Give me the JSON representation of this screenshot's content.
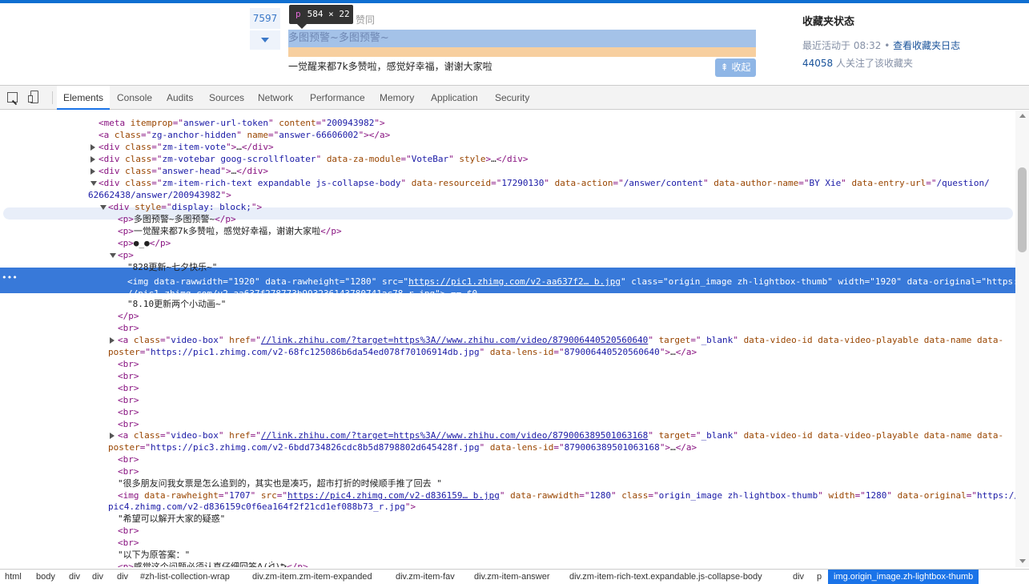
{
  "zhihu": {
    "vote_count": "7597",
    "tooltip_tag": "p",
    "tooltip_size": "584 × 22",
    "zan_label": "赞同",
    "highlighted_text": "多图预警~多图预警~",
    "line2": "一觉醒来都7k多赞啦，感觉好幸福，谢谢大家啦",
    "collapse_label": "收起",
    "sidebar": {
      "title": "收藏夹状态",
      "activity": "最近活动于 08:32",
      "bullet": "•",
      "log_link": "查看收藏夹日志",
      "followers_num": "44058",
      "followers_text": "人关注了该收藏夹"
    }
  },
  "devtools": {
    "tabs": [
      "Elements",
      "Console",
      "Audits",
      "Sources",
      "Network",
      "Performance",
      "Memory",
      "Application",
      "Security"
    ],
    "active_tab": "Elements",
    "breadcrumbs": [
      "html",
      "body",
      "div",
      "div",
      "div",
      "#zh-list-collection-wrap",
      "div.zm-item.zm-item-expanded",
      "div.zm-item-fav",
      "div.zm-item-answer",
      "div.zm-item-rich-text.expandable.js-collapse-body",
      "div",
      "p",
      "img.origin_image.zh-lightbox-thumb"
    ],
    "selected_crumb": "img.origin_image.zh-lightbox-thumb",
    "lines": [
      {
        "parts": [
          [
            "t",
            "<meta "
          ],
          [
            "an",
            "itemprop"
          ],
          [
            "t",
            "=\""
          ],
          [
            "av",
            "answer-url-token"
          ],
          [
            "t",
            "\" "
          ],
          [
            "an",
            "content"
          ],
          [
            "t",
            "=\""
          ],
          [
            "av",
            "200943982"
          ],
          [
            "t",
            "\">"
          ]
        ]
      },
      {
        "parts": [
          [
            "t",
            "<a "
          ],
          [
            "an",
            "class"
          ],
          [
            "t",
            "=\""
          ],
          [
            "av",
            "zg-anchor-hidden"
          ],
          [
            "t",
            "\" "
          ],
          [
            "an",
            "name"
          ],
          [
            "t",
            "=\""
          ],
          [
            "av",
            "answer-66606002"
          ],
          [
            "t",
            "\"></a>"
          ]
        ]
      },
      {
        "parts": [
          [
            "t",
            "<div "
          ],
          [
            "an",
            "class"
          ],
          [
            "t",
            "=\""
          ],
          [
            "av",
            "zm-item-vote"
          ],
          [
            "t",
            "\">"
          ],
          [
            "s",
            "…"
          ],
          [
            "t",
            "</div>"
          ]
        ]
      },
      {
        "parts": [
          [
            "t",
            "<div "
          ],
          [
            "an",
            "class"
          ],
          [
            "t",
            "=\""
          ],
          [
            "av",
            "zm-votebar goog-scrollfloater"
          ],
          [
            "t",
            "\" "
          ],
          [
            "an",
            "data-za-module"
          ],
          [
            "t",
            "=\""
          ],
          [
            "av",
            "VoteBar"
          ],
          [
            "t",
            "\" "
          ],
          [
            "an",
            "style"
          ],
          [
            "t",
            ">"
          ],
          [
            "s",
            "…"
          ],
          [
            "t",
            "</div>"
          ]
        ]
      },
      {
        "parts": [
          [
            "t",
            "<div "
          ],
          [
            "an",
            "class"
          ],
          [
            "t",
            "=\""
          ],
          [
            "av",
            "answer-head"
          ],
          [
            "t",
            "\">"
          ],
          [
            "s",
            "…"
          ],
          [
            "t",
            "</div>"
          ]
        ]
      },
      {
        "parts": [
          [
            "t",
            "<div "
          ],
          [
            "an",
            "class"
          ],
          [
            "t",
            "=\""
          ],
          [
            "av",
            "zm-item-rich-text expandable js-collapse-body"
          ],
          [
            "t",
            "\" "
          ],
          [
            "an",
            "data-resourceid"
          ],
          [
            "t",
            "=\""
          ],
          [
            "av",
            "17290130"
          ],
          [
            "t",
            "\" "
          ],
          [
            "an",
            "data-action"
          ],
          [
            "t",
            "=\""
          ],
          [
            "av",
            "/answer/content"
          ],
          [
            "t",
            "\" "
          ],
          [
            "an",
            "data-author-name"
          ],
          [
            "t",
            "=\""
          ],
          [
            "av",
            "BY Xie"
          ],
          [
            "t",
            "\" "
          ],
          [
            "an",
            "data-entry-url"
          ],
          [
            "t",
            "=\""
          ],
          [
            "av",
            "/question/"
          ]
        ]
      },
      {
        "parts": [
          [
            "av",
            "62662438/answer/200943982"
          ],
          [
            "t",
            "\">"
          ]
        ]
      },
      {
        "parts": [
          [
            "t",
            "<div "
          ],
          [
            "an",
            "style"
          ],
          [
            "t",
            "=\""
          ],
          [
            "av",
            "display: block;"
          ],
          [
            "t",
            "\">"
          ]
        ]
      },
      {
        "parts": [
          [
            "t",
            "<p>"
          ],
          [
            "s",
            "多图预警~多图预警~"
          ],
          [
            "t",
            "</p>"
          ]
        ]
      },
      {
        "parts": [
          [
            "t",
            "<p>"
          ],
          [
            "s",
            "一觉醒来都7k多赞啦，感觉好幸福，谢谢大家啦"
          ],
          [
            "t",
            "</p>"
          ]
        ]
      },
      {
        "parts": [
          [
            "t",
            "<p>"
          ],
          [
            "s",
            "●_●"
          ],
          [
            "t",
            "</p>"
          ]
        ]
      },
      {
        "parts": [
          [
            "t",
            "<p>"
          ]
        ]
      },
      {
        "parts": [
          [
            "s",
            "\"828更新~七夕快乐~\""
          ]
        ]
      },
      {
        "parts": [
          [
            "t",
            "<img "
          ],
          [
            "an",
            "data-rawwidth"
          ],
          [
            "t",
            "=\""
          ],
          [
            "av",
            "1920"
          ],
          [
            "t",
            "\" "
          ],
          [
            "an",
            "data-rawheight"
          ],
          [
            "t",
            "=\""
          ],
          [
            "av",
            "1280"
          ],
          [
            "t",
            "\" "
          ],
          [
            "an",
            "src"
          ],
          [
            "t",
            "=\""
          ],
          [
            "lk",
            "https://pic1.zhimg.com/v2-aa637f2… b.jpg"
          ],
          [
            "t",
            "\" "
          ],
          [
            "an",
            "class"
          ],
          [
            "t",
            "=\""
          ],
          [
            "av",
            "origin_image zh-lightbox-thumb"
          ],
          [
            "t",
            "\" "
          ],
          [
            "an",
            "width"
          ],
          [
            "t",
            "=\""
          ],
          [
            "av",
            "1920"
          ],
          [
            "t",
            "\" "
          ],
          [
            "an",
            "data-original"
          ],
          [
            "t",
            "=\""
          ],
          [
            "av",
            "https:"
          ]
        ]
      },
      {
        "parts": [
          [
            "av",
            "//pic1.zhimg.com/v2-aa637f278773b993236143780741ac78_r.jpg"
          ],
          [
            "t",
            "\"> "
          ],
          [
            "s",
            "== $0"
          ]
        ]
      },
      {
        "parts": [
          [
            "s",
            "\"8.10更新两个小动画~\""
          ]
        ]
      },
      {
        "parts": [
          [
            "t",
            "</p>"
          ]
        ]
      },
      {
        "parts": [
          [
            "t",
            "<br>"
          ]
        ]
      },
      {
        "parts": [
          [
            "t",
            "<a "
          ],
          [
            "an",
            "class"
          ],
          [
            "t",
            "=\""
          ],
          [
            "av",
            "video-box"
          ],
          [
            "t",
            "\" "
          ],
          [
            "an",
            "href"
          ],
          [
            "t",
            "=\""
          ],
          [
            "lk",
            "//link.zhihu.com/?target=https%3A//www.zhihu.com/video/879006440520560640"
          ],
          [
            "t",
            "\" "
          ],
          [
            "an",
            "target"
          ],
          [
            "t",
            "=\""
          ],
          [
            "av",
            "_blank"
          ],
          [
            "t",
            "\" "
          ],
          [
            "an",
            "data-video-id data-video-playable data-name data-"
          ]
        ]
      },
      {
        "parts": [
          [
            "an",
            "poster"
          ],
          [
            "t",
            "=\""
          ],
          [
            "av",
            "https://pic1.zhimg.com/v2-68fc125086b6da54ed078f70106914db.jpg"
          ],
          [
            "t",
            "\" "
          ],
          [
            "an",
            "data-lens-id"
          ],
          [
            "t",
            "=\""
          ],
          [
            "av",
            "879006440520560640"
          ],
          [
            "t",
            "\">"
          ],
          [
            "s",
            "…"
          ],
          [
            "t",
            "</a>"
          ]
        ]
      },
      {
        "parts": [
          [
            "t",
            "<br>"
          ]
        ]
      },
      {
        "parts": [
          [
            "t",
            "<br>"
          ]
        ]
      },
      {
        "parts": [
          [
            "t",
            "<br>"
          ]
        ]
      },
      {
        "parts": [
          [
            "t",
            "<br>"
          ]
        ]
      },
      {
        "parts": [
          [
            "t",
            "<br>"
          ]
        ]
      },
      {
        "parts": [
          [
            "t",
            "<br>"
          ]
        ]
      },
      {
        "parts": [
          [
            "t",
            "<a "
          ],
          [
            "an",
            "class"
          ],
          [
            "t",
            "=\""
          ],
          [
            "av",
            "video-box"
          ],
          [
            "t",
            "\" "
          ],
          [
            "an",
            "href"
          ],
          [
            "t",
            "=\""
          ],
          [
            "lk",
            "//link.zhihu.com/?target=https%3A//www.zhihu.com/video/879006389501063168"
          ],
          [
            "t",
            "\" "
          ],
          [
            "an",
            "target"
          ],
          [
            "t",
            "=\""
          ],
          [
            "av",
            "_blank"
          ],
          [
            "t",
            "\" "
          ],
          [
            "an",
            "data-video-id data-video-playable data-name data-"
          ]
        ]
      },
      {
        "parts": [
          [
            "an",
            "poster"
          ],
          [
            "t",
            "=\""
          ],
          [
            "av",
            "https://pic3.zhimg.com/v2-6bdd734826cdc8b5d8798802d645428f.jpg"
          ],
          [
            "t",
            "\" "
          ],
          [
            "an",
            "data-lens-id"
          ],
          [
            "t",
            "=\""
          ],
          [
            "av",
            "879006389501063168"
          ],
          [
            "t",
            "\">"
          ],
          [
            "s",
            "…"
          ],
          [
            "t",
            "</a>"
          ]
        ]
      },
      {
        "parts": [
          [
            "t",
            "<br>"
          ]
        ]
      },
      {
        "parts": [
          [
            "t",
            "<br>"
          ]
        ]
      },
      {
        "parts": [
          [
            "s",
            "\"很多朋友问我女票是怎么追到的，其实也是凑巧，超市打折的时候顺手推了回去 \""
          ]
        ]
      },
      {
        "parts": [
          [
            "t",
            "<img "
          ],
          [
            "an",
            "data-rawheight"
          ],
          [
            "t",
            "=\""
          ],
          [
            "av",
            "1707"
          ],
          [
            "t",
            "\" "
          ],
          [
            "an",
            "src"
          ],
          [
            "t",
            "=\""
          ],
          [
            "lk",
            "https://pic4.zhimg.com/v2-d836159… b.jpg"
          ],
          [
            "t",
            "\" "
          ],
          [
            "an",
            "data-rawwidth"
          ],
          [
            "t",
            "=\""
          ],
          [
            "av",
            "1280"
          ],
          [
            "t",
            "\" "
          ],
          [
            "an",
            "class"
          ],
          [
            "t",
            "=\""
          ],
          [
            "av",
            "origin_image zh-lightbox-thumb"
          ],
          [
            "t",
            "\" "
          ],
          [
            "an",
            "width"
          ],
          [
            "t",
            "=\""
          ],
          [
            "av",
            "1280"
          ],
          [
            "t",
            "\" "
          ],
          [
            "an",
            "data-original"
          ],
          [
            "t",
            "=\""
          ],
          [
            "av",
            "https://"
          ]
        ]
      },
      {
        "parts": [
          [
            "av",
            "pic4.zhimg.com/v2-d836159c0f6ea164f2f21cd1ef088b73_r.jpg"
          ],
          [
            "t",
            "\">"
          ]
        ]
      },
      {
        "parts": [
          [
            "s",
            "\"希望可以解开大家的疑惑\""
          ]
        ]
      },
      {
        "parts": [
          [
            "t",
            "<br>"
          ]
        ]
      },
      {
        "parts": [
          [
            "t",
            "<br>"
          ]
        ]
      },
      {
        "parts": [
          [
            "s",
            "\"以下为原答案：\""
          ]
        ]
      },
      {
        "parts": [
          [
            "t",
            "<p>"
          ],
          [
            "s",
            "感觉这个问题必须认真仔细回答ᕕ(ᐛ)ᕗ"
          ],
          [
            "t",
            "</p>"
          ]
        ]
      }
    ]
  }
}
